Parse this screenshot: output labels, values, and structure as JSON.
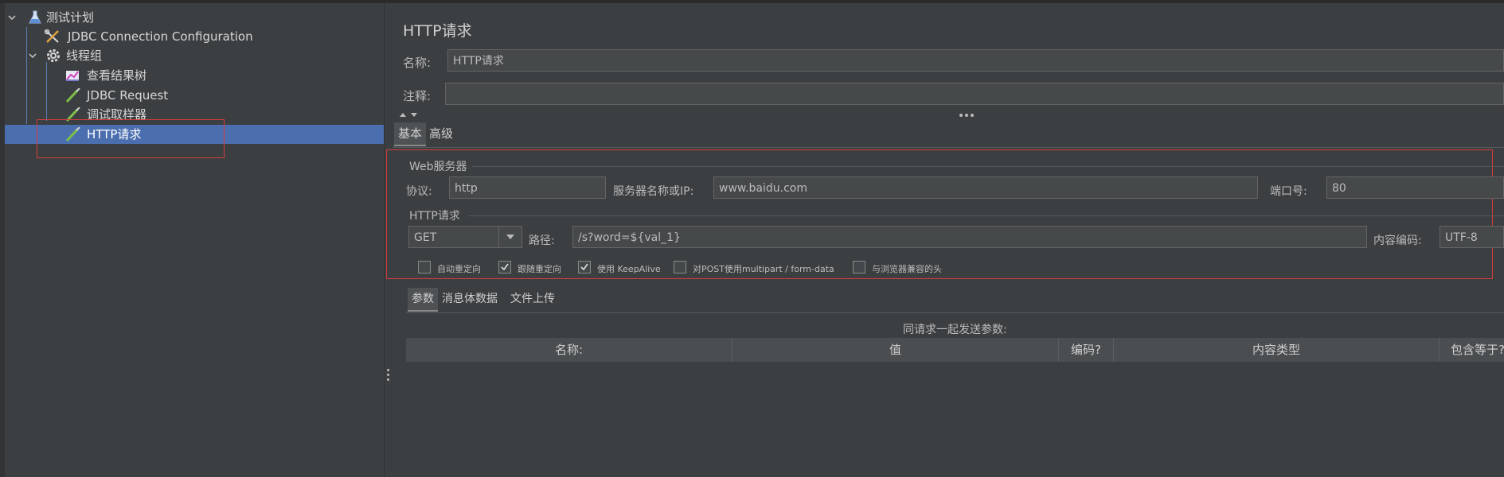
{
  "tree": {
    "items": [
      {
        "label": "测试计划",
        "icon": "flask-icon"
      },
      {
        "label": "JDBC Connection Configuration",
        "icon": "wrench-icon"
      },
      {
        "label": "线程组",
        "icon": "gear-icon"
      },
      {
        "label": "查看结果树",
        "icon": "chart-icon"
      },
      {
        "label": "JDBC Request",
        "icon": "pipette-icon"
      },
      {
        "label": "调试取样器",
        "icon": "pipette-icon"
      },
      {
        "label": "HTTP请求",
        "icon": "pipette-icon"
      }
    ],
    "selected_color": "#4b6eaf"
  },
  "panel": {
    "title": "HTTP请求",
    "name_label": "名称:",
    "name_value": "HTTP请求",
    "comment_label": "注释:",
    "comment_value": "",
    "tabs": [
      "基本",
      "高级"
    ],
    "web_server": {
      "group_label": "Web服务器",
      "protocol_label": "协议:",
      "protocol_value": "http",
      "server_label": "服务器名称或IP:",
      "server_value": "www.baidu.com",
      "port_label": "端口号:",
      "port_value": "80"
    },
    "http_request": {
      "group_label": "HTTP请求",
      "method": "GET",
      "path_label": "路径:",
      "path_value": "/s?word=${val_1}",
      "encoding_label": "内容编码:",
      "encoding_value": "UTF-8"
    },
    "options": [
      {
        "label": "自动重定向",
        "checked": false
      },
      {
        "label": "跟随重定向",
        "checked": true
      },
      {
        "label": "使用 KeepAlive",
        "checked": true
      },
      {
        "label": "对POST使用multipart / form-data",
        "checked": false
      },
      {
        "label": "与浏览器兼容的头",
        "checked": false
      }
    ],
    "sub_tabs": [
      "参数",
      "消息体数据",
      "文件上传"
    ],
    "params_caption": "同请求一起发送参数:",
    "columns": [
      "名称:",
      "值",
      "编码?",
      "内容类型",
      "包含等于?"
    ]
  },
  "colors": {
    "background": "#3c3f41",
    "field": "#45494a",
    "highlight_box": "#d23c3c",
    "selection": "#4b6eaf"
  }
}
